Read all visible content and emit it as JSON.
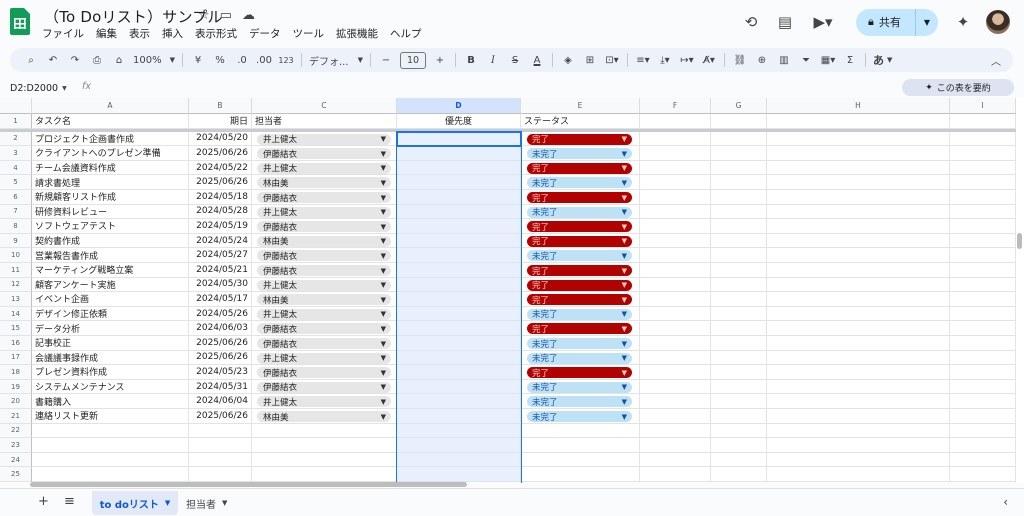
{
  "doc": {
    "title": "（To Doリスト）サンプル"
  },
  "menu": [
    "ファイル",
    "編集",
    "表示",
    "挿入",
    "表示形式",
    "データ",
    "ツール",
    "拡張機能",
    "ヘルプ"
  ],
  "share": {
    "label": "共有"
  },
  "toolbar": {
    "zoom": "100%",
    "currency": "¥",
    "percent": "%",
    "dec_decrease": ".0",
    "dec_increase": ".00",
    "number_format": "123",
    "font": "デフォ...",
    "font_size": "10",
    "input_mode": "あ"
  },
  "formula": {
    "name_box": "D2:D2000",
    "fx": "fx"
  },
  "summarize": {
    "label": "この表を要約"
  },
  "columns": [
    "A",
    "B",
    "C",
    "D",
    "E",
    "F",
    "G",
    "H",
    "I"
  ],
  "headers": {
    "task": "タスク名",
    "date": "期日",
    "owner": "担当者",
    "priority": "優先度",
    "status": "ステータス"
  },
  "rows": [
    {
      "task": "プロジェクト企画書作成",
      "date": "2024/05/20",
      "owner": "井上健太",
      "status": "完了"
    },
    {
      "task": "クライアントへのプレゼン準備",
      "date": "2025/06/26",
      "owner": "伊藤結衣",
      "status": "未完了"
    },
    {
      "task": "チーム会議資料作成",
      "date": "2024/05/22",
      "owner": "井上健太",
      "status": "完了"
    },
    {
      "task": "請求書処理",
      "date": "2025/06/26",
      "owner": "林由美",
      "status": "未完了"
    },
    {
      "task": "新規顧客リスト作成",
      "date": "2024/05/18",
      "owner": "伊藤結衣",
      "status": "完了"
    },
    {
      "task": "研修資料レビュー",
      "date": "2024/05/28",
      "owner": "井上健太",
      "status": "未完了"
    },
    {
      "task": "ソフトウェアテスト",
      "date": "2024/05/19",
      "owner": "伊藤結衣",
      "status": "完了"
    },
    {
      "task": "契約書作成",
      "date": "2024/05/24",
      "owner": "林由美",
      "status": "完了"
    },
    {
      "task": "営業報告書作成",
      "date": "2024/05/27",
      "owner": "伊藤結衣",
      "status": "未完了"
    },
    {
      "task": "マーケティング戦略立案",
      "date": "2024/05/21",
      "owner": "伊藤結衣",
      "status": "完了"
    },
    {
      "task": "顧客アンケート実施",
      "date": "2024/05/30",
      "owner": "井上健太",
      "status": "完了"
    },
    {
      "task": "イベント企画",
      "date": "2024/05/17",
      "owner": "林由美",
      "status": "完了"
    },
    {
      "task": "デザイン修正依頼",
      "date": "2024/05/26",
      "owner": "井上健太",
      "status": "未完了"
    },
    {
      "task": "データ分析",
      "date": "2024/06/03",
      "owner": "伊藤結衣",
      "status": "完了"
    },
    {
      "task": "記事校正",
      "date": "2025/06/26",
      "owner": "伊藤結衣",
      "status": "未完了"
    },
    {
      "task": "会議議事録作成",
      "date": "2025/06/26",
      "owner": "井上健太",
      "status": "未完了"
    },
    {
      "task": "プレゼン資料作成",
      "date": "2024/05/23",
      "owner": "伊藤結衣",
      "status": "完了"
    },
    {
      "task": "システムメンテナンス",
      "date": "2024/05/31",
      "owner": "伊藤結衣",
      "status": "未完了"
    },
    {
      "task": "書籍購入",
      "date": "2024/06/04",
      "owner": "井上健太",
      "status": "未完了"
    },
    {
      "task": "連絡リスト更新",
      "date": "2025/06/26",
      "owner": "林由美",
      "status": "未完了"
    }
  ],
  "row_numbers": [
    "1",
    "2",
    "3",
    "4",
    "5",
    "6",
    "7",
    "8",
    "9",
    "10",
    "11",
    "12",
    "13",
    "14",
    "15",
    "16",
    "17",
    "18",
    "19",
    "20",
    "21",
    "22",
    "23",
    "24",
    "25"
  ],
  "status_colors": {
    "done_bg": "#b10202",
    "done_fg": "#ffcfc9",
    "todo_bg": "#bfe1f6",
    "todo_fg": "#0a53a8"
  },
  "sheets": [
    {
      "name": "to doリスト",
      "active": true
    },
    {
      "name": "担当者",
      "active": false
    }
  ]
}
